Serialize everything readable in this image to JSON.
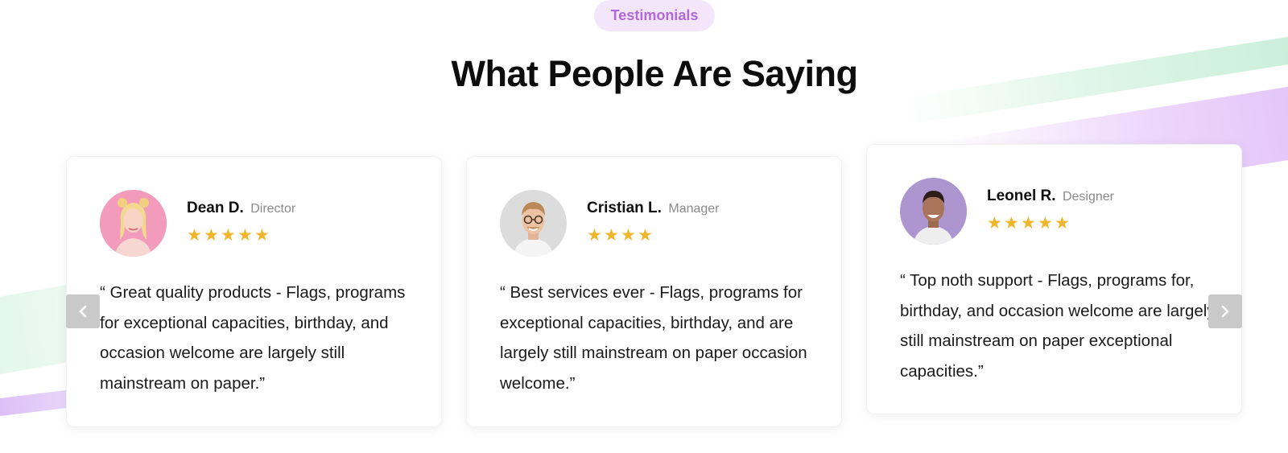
{
  "section_pill": "Testimonials",
  "heading": "What People Are Saying",
  "colors": {
    "accent_purple": "#b168d8",
    "pill_bg": "#f3e6fa",
    "star": "#f1b52b",
    "nav_button": "#c9c9c9"
  },
  "testimonials": [
    {
      "name": "Dean D.",
      "role": "Director",
      "rating": 5,
      "stars": "★★★★★",
      "avatar_icon": "avatar-photo-woman-pink-background",
      "quote": "“ Great quality products - Flags, programs for exceptional capacities, birthday, and occasion welcome are largely still mainstream on paper.”"
    },
    {
      "name": "Cristian L.",
      "role": "Manager",
      "rating": 4,
      "stars": "★★★★",
      "avatar_icon": "avatar-photo-man-glasses-grey-background",
      "quote": "“ Best services ever - Flags, programs for exceptional capacities, birthday, and are largely still mainstream on paper occasion welcome.”"
    },
    {
      "name": "Leonel R.",
      "role": "Designer",
      "rating": 5,
      "stars": "★★★★★",
      "avatar_icon": "avatar-photo-man-purple-background",
      "quote": "“ Top noth support - Flags, programs for, birthday, and occasion welcome are largely still mainstream on paper exceptional capacities.”"
    }
  ],
  "nav": {
    "prev_icon": "chevron-left-icon",
    "next_icon": "chevron-right-icon"
  }
}
